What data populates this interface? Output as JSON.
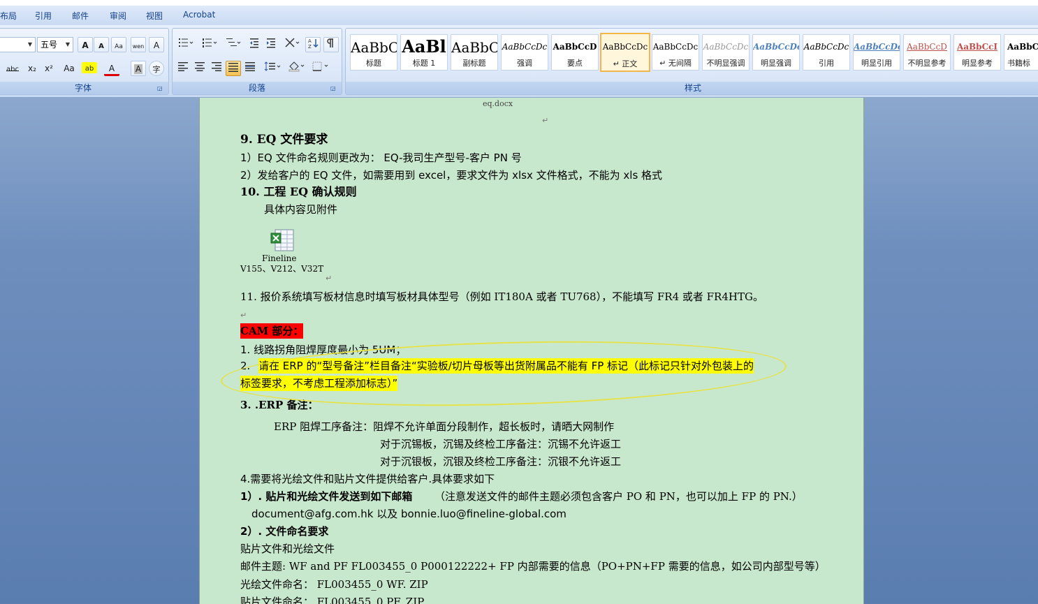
{
  "tabs": [
    "布局",
    "引用",
    "邮件",
    "审阅",
    "视图",
    "Acrobat"
  ],
  "font_group": {
    "label": "字体",
    "font_size": "五号",
    "buttons": [
      "A",
      "A",
      "Aa",
      "wen",
      "A",
      "abc",
      "x₂",
      "x²",
      "Aa",
      "ab",
      "A",
      "A",
      "字"
    ]
  },
  "paragraph_group": {
    "label": "段落"
  },
  "styles_group": {
    "label": "样式",
    "items": [
      {
        "sample": "AaBbC",
        "name": "标题"
      },
      {
        "sample": "AaBl",
        "name": "标题 1"
      },
      {
        "sample": "AaBbC",
        "name": "副标题"
      },
      {
        "sample": "AaBbCcDc",
        "name": "强调"
      },
      {
        "sample": "AaBbCcD",
        "name": "要点"
      },
      {
        "sample": "AaBbCcDc",
        "name": "↵ 正文"
      },
      {
        "sample": "AaBbCcDc",
        "name": "↵ 无间隔"
      },
      {
        "sample": "AaBbCcDc",
        "name": "不明显强调"
      },
      {
        "sample": "AaBbCcDc",
        "name": "明显强调"
      },
      {
        "sample": "AaBbCcDc",
        "name": "引用"
      },
      {
        "sample": "AaBbCcDc",
        "name": "明显引用"
      },
      {
        "sample": "AaBbCcD",
        "name": "不明显参考"
      },
      {
        "sample": "AaBbCcI",
        "name": "明显参考"
      },
      {
        "sample": "AaBbC",
        "name": "书籍标"
      }
    ]
  },
  "colors": {
    "page_bg": "#c7e8cc",
    "highlight_yellow": "#ffff00",
    "highlight_red": "#ff0000",
    "accent": "#15428b"
  },
  "document": {
    "header": "eq.docx",
    "l1": "9. EQ 文件要求",
    "l2": "1）EQ 文件命名规则更改为： EQ-我司生产型号-客户 PN 号",
    "l3": "2）发给客户的 EQ 文件，如需要用到 excel，要求文件为 xlsx 文件格式，不能为 xls 格式",
    "l4": "10. 工程 EQ 确认规则",
    "l5": "具体内容见附件",
    "attach_name": "Fineline",
    "attach_caption": "V155、V212、V32T",
    "l6": "11. 报价系统填写板材信息时填写板材具体型号（例如 IT180A 或者 TU768），不能填写 FR4 或者 FR4HTG。",
    "l7": "CAM 部分：",
    "l8": "1.   线路拐角阻焊厚度最小为 5UM；",
    "l9_num": "2.",
    "l9": "请在 ERP 的“型号备注”栏目备注“实验板/切片母板等出货附属品不能有 FP 标记（此标记只针对外包装上的",
    "l10": "标签要求，不考虑工程添加标志）”",
    "l11": "3. .ERP 备注：",
    "l12": "ERP 阻焊工序备注：阻焊不允许单面分段制作，超长板时，请晒大网制作",
    "l13": "对于沉锡板，沉锡及终检工序备注：沉锡不允许返工",
    "l14": "对于沉银板，沉银及终检工序备注：沉银不允许返工",
    "l15": "4.需要将光绘文件和贴片文件提供给客户.具体要求如下",
    "l16a": "1）. 贴片和光绘文件发送到如下邮箱",
    "l16b": "（注意发送文件的邮件主题必须包含客户 PO 和 PN，也可以加上 FP 的 PN.）",
    "l17": "document@afg.com.hk 以及 bonnie.luo@fineline-global.com",
    "l18": "2）. 文件命名要求",
    "l19": "贴片文件和光绘文件",
    "l20": "邮件主题: WF and PF FL003455_0 P000122222+ FP 内部需要的信息（PO+PN+FP 需要的信息，如公司内部型号等）",
    "l21": "光绘文件命名： FL003455_0 WF. ZIP",
    "l22": "贴片文件命名： FL003455_0 PF. ZIP",
    "para_mark": "↵"
  }
}
